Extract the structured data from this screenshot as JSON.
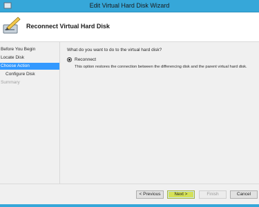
{
  "window": {
    "title": "Edit Virtual Hard Disk Wizard"
  },
  "header": {
    "heading": "Reconnect Virtual Hard Disk",
    "icon": "disk-edit-icon"
  },
  "steps": [
    {
      "label": "Before You Begin",
      "state": "normal"
    },
    {
      "label": "Locate Disk",
      "state": "normal"
    },
    {
      "label": "Choose Action",
      "state": "active"
    },
    {
      "label": "Configure Disk",
      "state": "sub"
    },
    {
      "label": "Summary",
      "state": "disabled"
    }
  ],
  "content": {
    "question": "What do you want to do to the virtual hard disk?",
    "option_label": "Reconnect",
    "option_desc": "This option restores the connection between the differencing disk and the parent virtual hard disk."
  },
  "buttons": {
    "previous": "< Previous",
    "next": "Next >",
    "finish": "Finish",
    "cancel": "Cancel"
  },
  "colors": {
    "titlebar": "#36a7d9",
    "active_step": "#3399ff",
    "next_highlight": "#d4e157"
  }
}
